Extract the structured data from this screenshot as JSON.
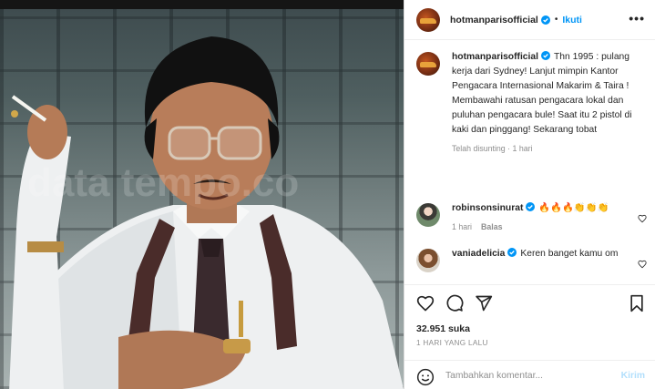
{
  "post": {
    "username": "hotmanparisofficial",
    "follow_label": "Ikuti",
    "dot": "•",
    "more_label": "•••"
  },
  "caption": {
    "username": "hotmanparisofficial",
    "text": "Thn 1995 : pulang kerja dari Sydney! Lanjut mimpin Kantor Pengacara Internasional Makarim & Taira ! Membawahi ratusan pengacara lokal dan puluhan pengacara bule! Saat itu 2 pistol di kaki dan pinggang! Sekarang tobat",
    "meta": "Telah disunting · 1 hari"
  },
  "comments": [
    {
      "username": "robinsonsinurat",
      "text": "🔥🔥🔥👏👏👏",
      "time": "1 hari",
      "reply_label": "Balas"
    },
    {
      "username": "vaniadelicia",
      "text": "Keren banget kamu om"
    }
  ],
  "stats": {
    "likes": "32.951 suka",
    "time_ago": "1 HARI YANG LALU"
  },
  "composer": {
    "placeholder": "Tambahkan komentar...",
    "send_label": "Kirim"
  },
  "colors": {
    "accent": "#0095f6",
    "muted": "#8e8e8e",
    "send_disabled": "#b2dffc"
  }
}
